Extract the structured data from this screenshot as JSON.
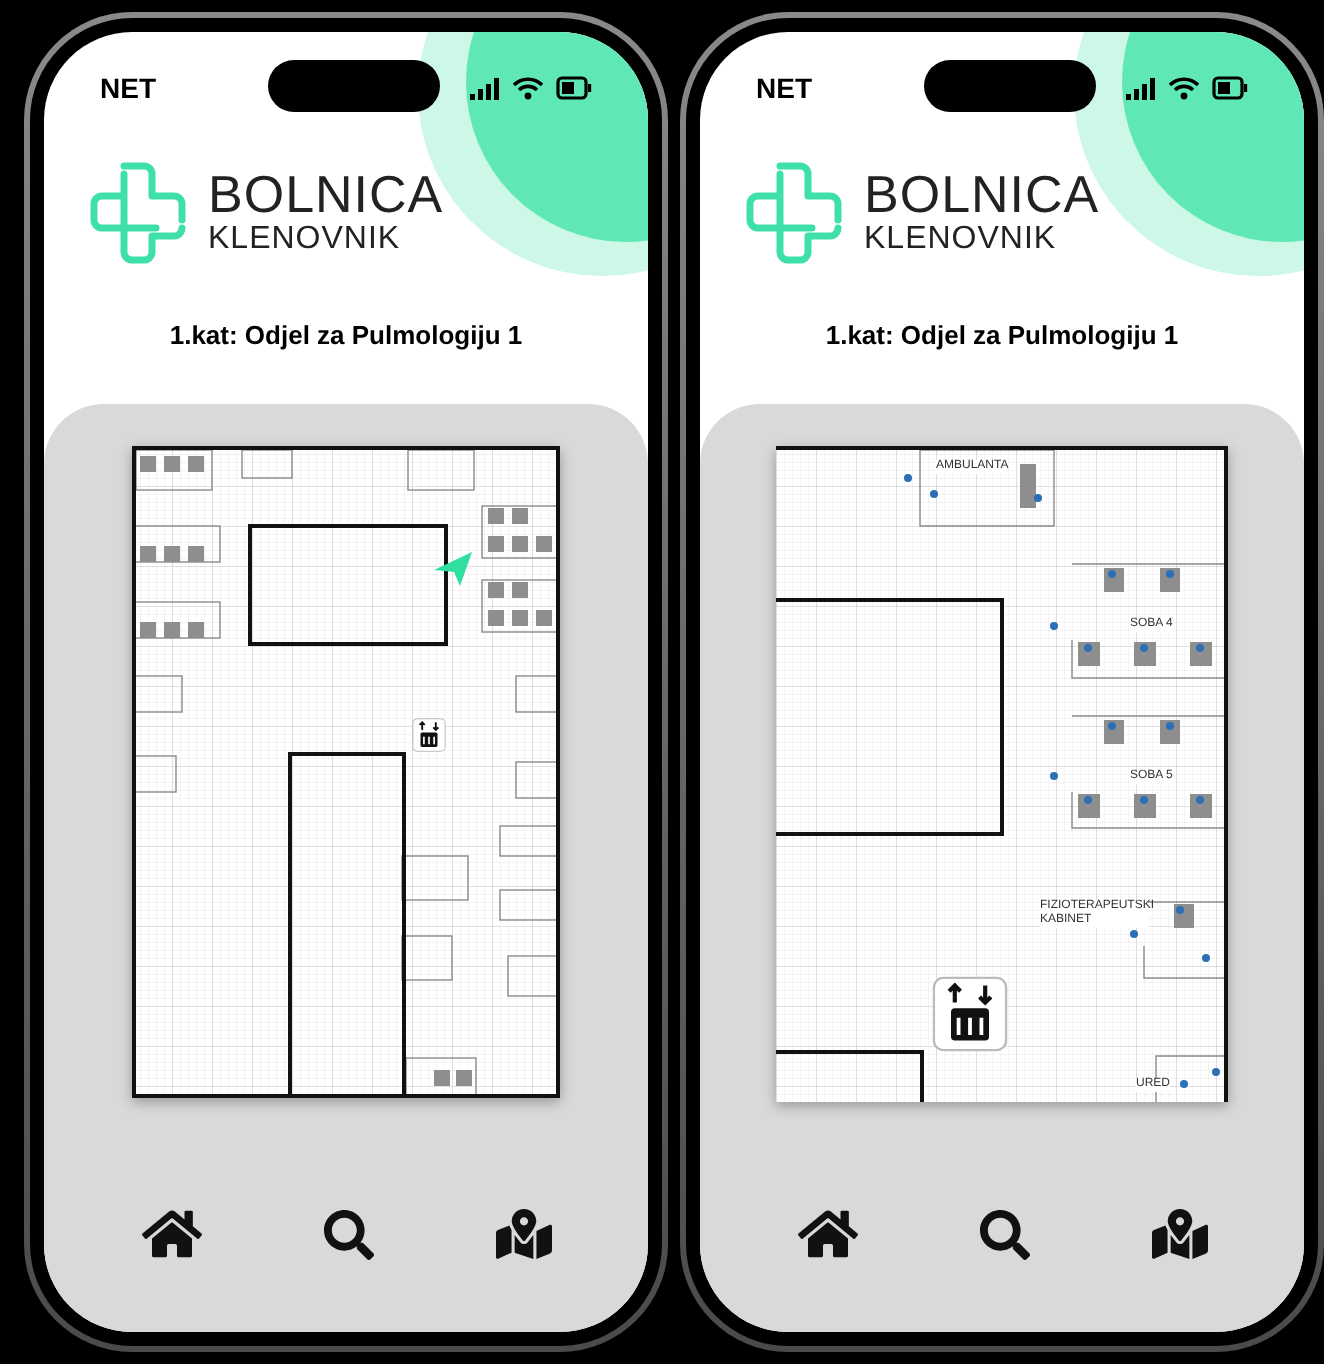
{
  "phones": [
    {
      "status": {
        "carrier": "NET"
      },
      "logo": {
        "name": "BOLNICA",
        "subtitle": "KLENOVNIK"
      },
      "title": "1.kat: Odjel za Pulmologiju 1",
      "floor_plan": {
        "kind": "overview",
        "location_marker": true
      }
    },
    {
      "status": {
        "carrier": "NET"
      },
      "logo": {
        "name": "BOLNICA",
        "subtitle": "KLENOVNIK"
      },
      "title": "1.kat: Odjel za Pulmologiju 1",
      "floor_plan": {
        "kind": "detail",
        "rooms": [
          {
            "label": "AMBULANTA"
          },
          {
            "label": "SOBA 4"
          },
          {
            "label": "SOBA 5"
          },
          {
            "label": "FIZIOTERAPEUTSKI KABINET"
          },
          {
            "label": "URED"
          }
        ]
      }
    }
  ]
}
